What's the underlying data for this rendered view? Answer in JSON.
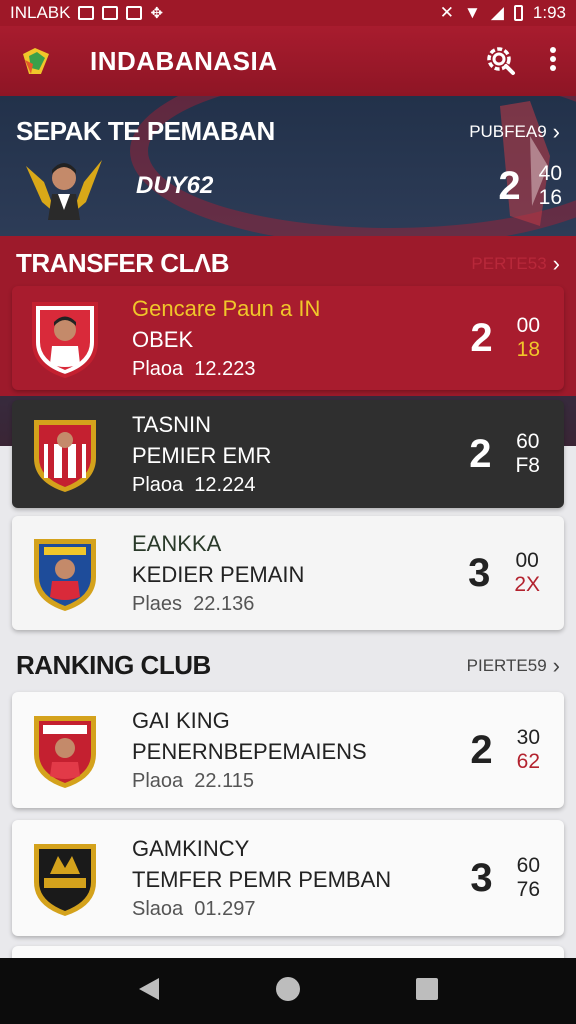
{
  "status_bar": {
    "carrier": "INLABK",
    "time": "1:93"
  },
  "app_bar": {
    "title": "INDABANASIA"
  },
  "hero": {
    "title": "SEPAK TE PEMABAN",
    "more_label": "PUBFEA9",
    "featured": {
      "name": "DUY62",
      "score": "2",
      "score_top": "40",
      "score_bottom": "16"
    }
  },
  "transfer": {
    "title": "TRANSFER CLɅB",
    "more_label": "PERTE53",
    "items": [
      {
        "line1": "Gencare Paun a IN",
        "line2": "OBEK",
        "line3": "Plaoa  12.223",
        "score": "2",
        "score_top": "00",
        "score_bottom": "18"
      },
      {
        "line1": "TASNIN",
        "line2": "PEMIER EMR",
        "line3": "Plaoa  12.224",
        "score": "2",
        "score_top": "60",
        "score_bottom": "F8"
      },
      {
        "line1": "EANKKA",
        "line2": "KEDIER PEMAIN",
        "line3": "Plaes  22.136",
        "score": "3",
        "score_top": "00",
        "score_bottom": "2X"
      }
    ]
  },
  "ranking": {
    "title": "RANKING CLUB",
    "more_label": "PIERTE59",
    "items": [
      {
        "line1": "GAI KING",
        "line2": "PENERNBEPEMAIENS",
        "line3": "Plaoa  22.115",
        "score": "2",
        "score_top": "30",
        "score_bottom": "62"
      },
      {
        "line1": "GAMKINCY",
        "line2": "TEMFER PEMR PEMBAN",
        "line3": "Slaoa  01.297",
        "score": "3",
        "score_top": "60",
        "score_bottom": "76"
      }
    ]
  },
  "colors": {
    "brand_red": "#a81c2e",
    "dark_card": "#2f2f2f",
    "accent_yellow": "#f0c62a",
    "accent_red": "#b3222e"
  },
  "icons": [
    "app-logo-icon",
    "search-gear-icon",
    "overflow-menu-icon",
    "back-nav-icon",
    "home-nav-icon",
    "recents-nav-icon"
  ]
}
